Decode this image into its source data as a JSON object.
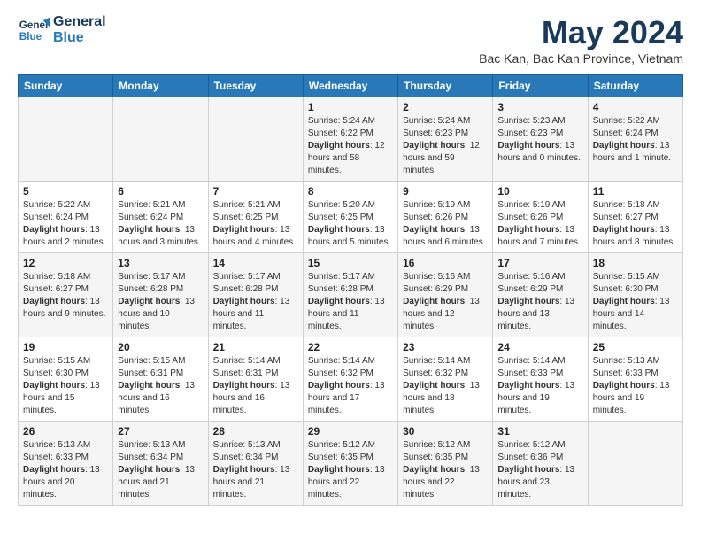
{
  "logo": {
    "line1": "General",
    "line2": "Blue"
  },
  "title": "May 2024",
  "location": "Bac Kan, Bac Kan Province, Vietnam",
  "header_days": [
    "Sunday",
    "Monday",
    "Tuesday",
    "Wednesday",
    "Thursday",
    "Friday",
    "Saturday"
  ],
  "weeks": [
    [
      {
        "day": "",
        "info": ""
      },
      {
        "day": "",
        "info": ""
      },
      {
        "day": "",
        "info": ""
      },
      {
        "day": "1",
        "info": "Sunrise: 5:24 AM\nSunset: 6:22 PM\nDaylight: 12 hours and 58 minutes."
      },
      {
        "day": "2",
        "info": "Sunrise: 5:24 AM\nSunset: 6:23 PM\nDaylight: 12 hours and 59 minutes."
      },
      {
        "day": "3",
        "info": "Sunrise: 5:23 AM\nSunset: 6:23 PM\nDaylight: 13 hours and 0 minutes."
      },
      {
        "day": "4",
        "info": "Sunrise: 5:22 AM\nSunset: 6:24 PM\nDaylight: 13 hours and 1 minute."
      }
    ],
    [
      {
        "day": "5",
        "info": "Sunrise: 5:22 AM\nSunset: 6:24 PM\nDaylight: 13 hours and 2 minutes."
      },
      {
        "day": "6",
        "info": "Sunrise: 5:21 AM\nSunset: 6:24 PM\nDaylight: 13 hours and 3 minutes."
      },
      {
        "day": "7",
        "info": "Sunrise: 5:21 AM\nSunset: 6:25 PM\nDaylight: 13 hours and 4 minutes."
      },
      {
        "day": "8",
        "info": "Sunrise: 5:20 AM\nSunset: 6:25 PM\nDaylight: 13 hours and 5 minutes."
      },
      {
        "day": "9",
        "info": "Sunrise: 5:19 AM\nSunset: 6:26 PM\nDaylight: 13 hours and 6 minutes."
      },
      {
        "day": "10",
        "info": "Sunrise: 5:19 AM\nSunset: 6:26 PM\nDaylight: 13 hours and 7 minutes."
      },
      {
        "day": "11",
        "info": "Sunrise: 5:18 AM\nSunset: 6:27 PM\nDaylight: 13 hours and 8 minutes."
      }
    ],
    [
      {
        "day": "12",
        "info": "Sunrise: 5:18 AM\nSunset: 6:27 PM\nDaylight: 13 hours and 9 minutes."
      },
      {
        "day": "13",
        "info": "Sunrise: 5:17 AM\nSunset: 6:28 PM\nDaylight: 13 hours and 10 minutes."
      },
      {
        "day": "14",
        "info": "Sunrise: 5:17 AM\nSunset: 6:28 PM\nDaylight: 13 hours and 11 minutes."
      },
      {
        "day": "15",
        "info": "Sunrise: 5:17 AM\nSunset: 6:28 PM\nDaylight: 13 hours and 11 minutes."
      },
      {
        "day": "16",
        "info": "Sunrise: 5:16 AM\nSunset: 6:29 PM\nDaylight: 13 hours and 12 minutes."
      },
      {
        "day": "17",
        "info": "Sunrise: 5:16 AM\nSunset: 6:29 PM\nDaylight: 13 hours and 13 minutes."
      },
      {
        "day": "18",
        "info": "Sunrise: 5:15 AM\nSunset: 6:30 PM\nDaylight: 13 hours and 14 minutes."
      }
    ],
    [
      {
        "day": "19",
        "info": "Sunrise: 5:15 AM\nSunset: 6:30 PM\nDaylight: 13 hours and 15 minutes."
      },
      {
        "day": "20",
        "info": "Sunrise: 5:15 AM\nSunset: 6:31 PM\nDaylight: 13 hours and 16 minutes."
      },
      {
        "day": "21",
        "info": "Sunrise: 5:14 AM\nSunset: 6:31 PM\nDaylight: 13 hours and 16 minutes."
      },
      {
        "day": "22",
        "info": "Sunrise: 5:14 AM\nSunset: 6:32 PM\nDaylight: 13 hours and 17 minutes."
      },
      {
        "day": "23",
        "info": "Sunrise: 5:14 AM\nSunset: 6:32 PM\nDaylight: 13 hours and 18 minutes."
      },
      {
        "day": "24",
        "info": "Sunrise: 5:14 AM\nSunset: 6:33 PM\nDaylight: 13 hours and 19 minutes."
      },
      {
        "day": "25",
        "info": "Sunrise: 5:13 AM\nSunset: 6:33 PM\nDaylight: 13 hours and 19 minutes."
      }
    ],
    [
      {
        "day": "26",
        "info": "Sunrise: 5:13 AM\nSunset: 6:33 PM\nDaylight: 13 hours and 20 minutes."
      },
      {
        "day": "27",
        "info": "Sunrise: 5:13 AM\nSunset: 6:34 PM\nDaylight: 13 hours and 21 minutes."
      },
      {
        "day": "28",
        "info": "Sunrise: 5:13 AM\nSunset: 6:34 PM\nDaylight: 13 hours and 21 minutes."
      },
      {
        "day": "29",
        "info": "Sunrise: 5:12 AM\nSunset: 6:35 PM\nDaylight: 13 hours and 22 minutes."
      },
      {
        "day": "30",
        "info": "Sunrise: 5:12 AM\nSunset: 6:35 PM\nDaylight: 13 hours and 22 minutes."
      },
      {
        "day": "31",
        "info": "Sunrise: 5:12 AM\nSunset: 6:36 PM\nDaylight: 13 hours and 23 minutes."
      },
      {
        "day": "",
        "info": ""
      }
    ]
  ]
}
